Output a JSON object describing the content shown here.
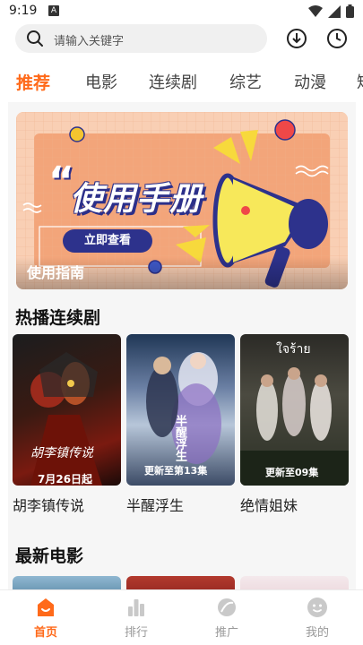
{
  "status": {
    "time": "9:19",
    "notification_badge": "A"
  },
  "search": {
    "placeholder": "请输入关键字"
  },
  "tabs": [
    {
      "label": "推荐",
      "active": true
    },
    {
      "label": "电影",
      "active": false
    },
    {
      "label": "连续剧",
      "active": false
    },
    {
      "label": "综艺",
      "active": false
    },
    {
      "label": "动漫",
      "active": false
    },
    {
      "label": "短",
      "active": false
    }
  ],
  "banner": {
    "quote_mark": "“",
    "title": "使用手册",
    "button_label": "立即查看",
    "caption": "使用指南"
  },
  "sections": {
    "hot_series": {
      "title": "热播连续剧",
      "items": [
        {
          "title": "胡李镇传说",
          "poster_text": "胡李镇传说",
          "poster_badge": "7月26日起"
        },
        {
          "title": "半醒浮生",
          "poster_text": "半醒浮生",
          "poster_badge": "更新至第13集"
        },
        {
          "title": "绝情姐妹",
          "poster_text": "ใจร้าย",
          "poster_badge": "更新至09集"
        }
      ]
    },
    "new_movies": {
      "title": "最新电影"
    }
  },
  "bottom_nav": [
    {
      "label": "首页",
      "icon": "home-icon",
      "active": true
    },
    {
      "label": "排行",
      "icon": "ranking-icon",
      "active": false
    },
    {
      "label": "推广",
      "icon": "promote-icon",
      "active": false
    },
    {
      "label": "我的",
      "icon": "profile-icon",
      "active": false
    }
  ],
  "colors": {
    "accent": "#ff6a1a",
    "banner_navy": "#2d328c",
    "inactive": "#999999"
  }
}
